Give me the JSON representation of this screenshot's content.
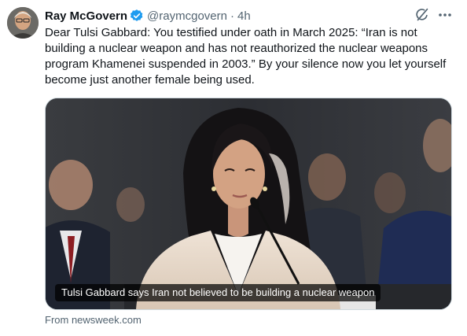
{
  "author": {
    "name": "Ray McGovern",
    "handle": "@raymcgovern",
    "separator": "·",
    "time": "4h"
  },
  "tweet": {
    "text": "Dear Tulsi Gabbard: You testified under oath in March 2025: “Iran is not building a nuclear weapon and has not reauthorized the nuclear weapons program Khamenei suspended in 2003.” By your silence now you let yourself become just another female being used."
  },
  "card": {
    "caption": "Tulsi Gabbard says Iran not believed to be building a nuclear weapon",
    "source": "From newsweek.com"
  },
  "colors": {
    "verified": "#1d9bf0",
    "muted": "#536471",
    "text": "#0f1419"
  },
  "icons": [
    "verified-badge-icon",
    "grok-icon",
    "more-icon"
  ]
}
